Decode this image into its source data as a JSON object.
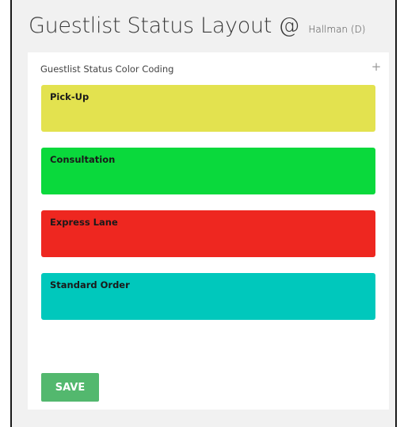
{
  "page": {
    "title": "Guestlist Status Layout @",
    "location": "Hallman (D)"
  },
  "panel": {
    "header": "Guestlist Status Color Coding",
    "add_label": "+"
  },
  "statuses": [
    {
      "label": "Pick-Up",
      "color": "#e3e24f"
    },
    {
      "label": "Consultation",
      "color": "#0ad93c"
    },
    {
      "label": "Express Lane",
      "color": "#ee2720"
    },
    {
      "label": "Standard Order",
      "color": "#00c8bc"
    }
  ],
  "save": {
    "label": "SAVE",
    "color": "#53b86e"
  }
}
